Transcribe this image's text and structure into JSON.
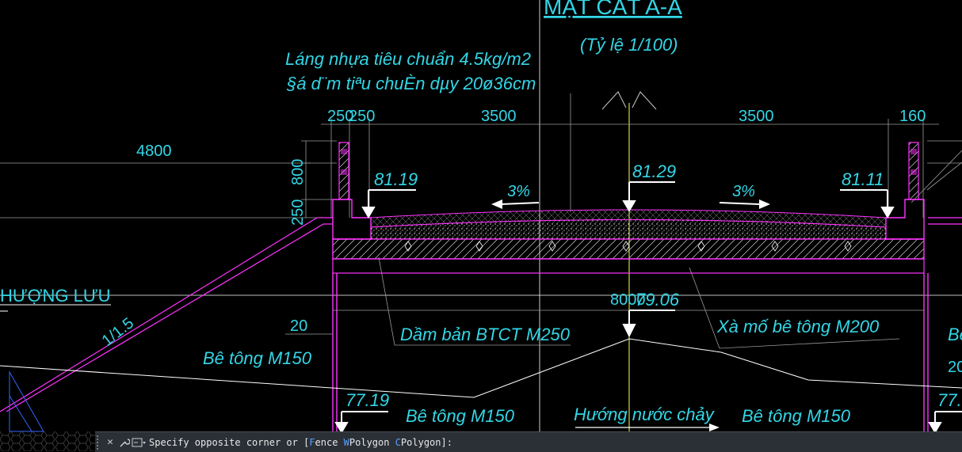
{
  "drawing": {
    "title": "MẶT CẮT A-A",
    "scale": "(Tỷ lệ 1/100)",
    "note_line1": "Láng nhựa tiêu chuẩn 4.5kg/m2",
    "note_line2": "§á d¨m tiªu chuÈn dµy 20ø36cm",
    "dim_250_top": "250",
    "dim_250_left": "250",
    "dim_3500_left": "3500",
    "dim_3500_right": "3500",
    "dim_160": "160",
    "dim_4800": "4800",
    "dim_800": "800",
    "dim_250_vert": "250",
    "elev_left": "81.19",
    "elev_center": "81.29",
    "elev_right": "81.11",
    "slope_left": "3%",
    "slope_right": "3%",
    "dim_8000": "8000",
    "elev_beam": "79.06",
    "upstream_label": "HƯỢNG LƯU",
    "slope_ratio": "1/1.5",
    "dim_20_left": "20",
    "beam_label": "Dầm bản BTCT M250",
    "abutment_label": "Xà mố bê tông M200",
    "concrete_1": "Bê tông M150",
    "concrete_2": "Bê tông M150",
    "concrete_3": "Bê tông M150",
    "elev_bottom_left": "77.19",
    "flow_label": "Hướng nước chảy",
    "right_cut_be": "Bê",
    "right_cut_20": "20",
    "right_cut_77": "77."
  },
  "colors": {
    "background": "#000000",
    "cyan": "#33d6e6",
    "magenta": "#ff33ff",
    "white": "#ffffff",
    "grey": "#9a9a9a",
    "yellow": "#ffff55"
  },
  "cmdbar": {
    "close_icon": "close-icon",
    "wrench_icon": "wrench-icon",
    "prompt_icon": "command-prompt-icon",
    "text_before": "Specify opposite corner or [",
    "opt1_key": "F",
    "opt1_rest": "ence ",
    "opt2_key": "W",
    "opt2_rest": "Polygon ",
    "opt3_key": "C",
    "opt3_rest": "Polygon",
    "text_after": "]:"
  }
}
